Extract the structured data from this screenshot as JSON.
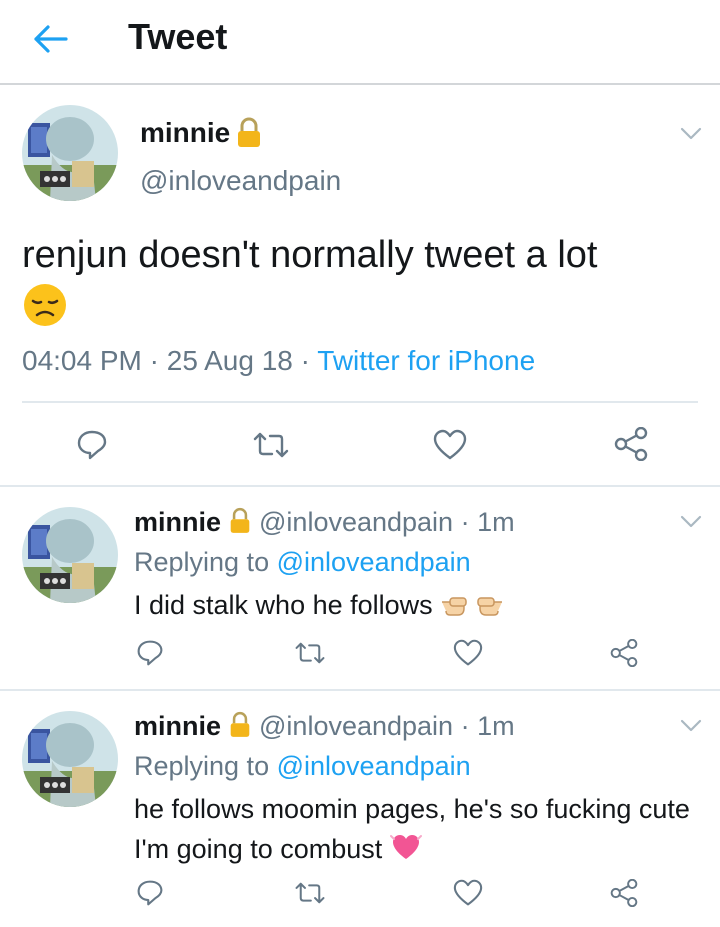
{
  "header": {
    "title": "Tweet"
  },
  "main_tweet": {
    "name": "minnie",
    "handle": "@inloveandpain",
    "text": "renjun doesn't normally tweet a lot",
    "time": "04:04 PM",
    "date": "25 Aug 18",
    "source": "Twitter for iPhone"
  },
  "replies": [
    {
      "name": "minnie",
      "handle": "@inloveandpain",
      "time_ago": "1m",
      "replying_label": "Replying to",
      "replying_to": "@inloveandpain",
      "text": "I did stalk who he follows"
    },
    {
      "name": "minnie",
      "handle": "@inloveandpain",
      "time_ago": "1m",
      "replying_label": "Replying to",
      "replying_to": "@inloveandpain",
      "text": "he follows moomin pages, he's so fucking cute I'm going to combust"
    }
  ],
  "colors": {
    "accent": "#1da1f2",
    "secondary_text": "#657786",
    "icon": "#657786"
  },
  "icons": [
    "back-arrow-icon",
    "lock-icon",
    "chevron-down-icon",
    "reply-icon",
    "retweet-icon",
    "like-icon",
    "share-icon",
    "disappointed-face-emoji",
    "pointing-hands-emoji",
    "growing-heart-emoji"
  ]
}
